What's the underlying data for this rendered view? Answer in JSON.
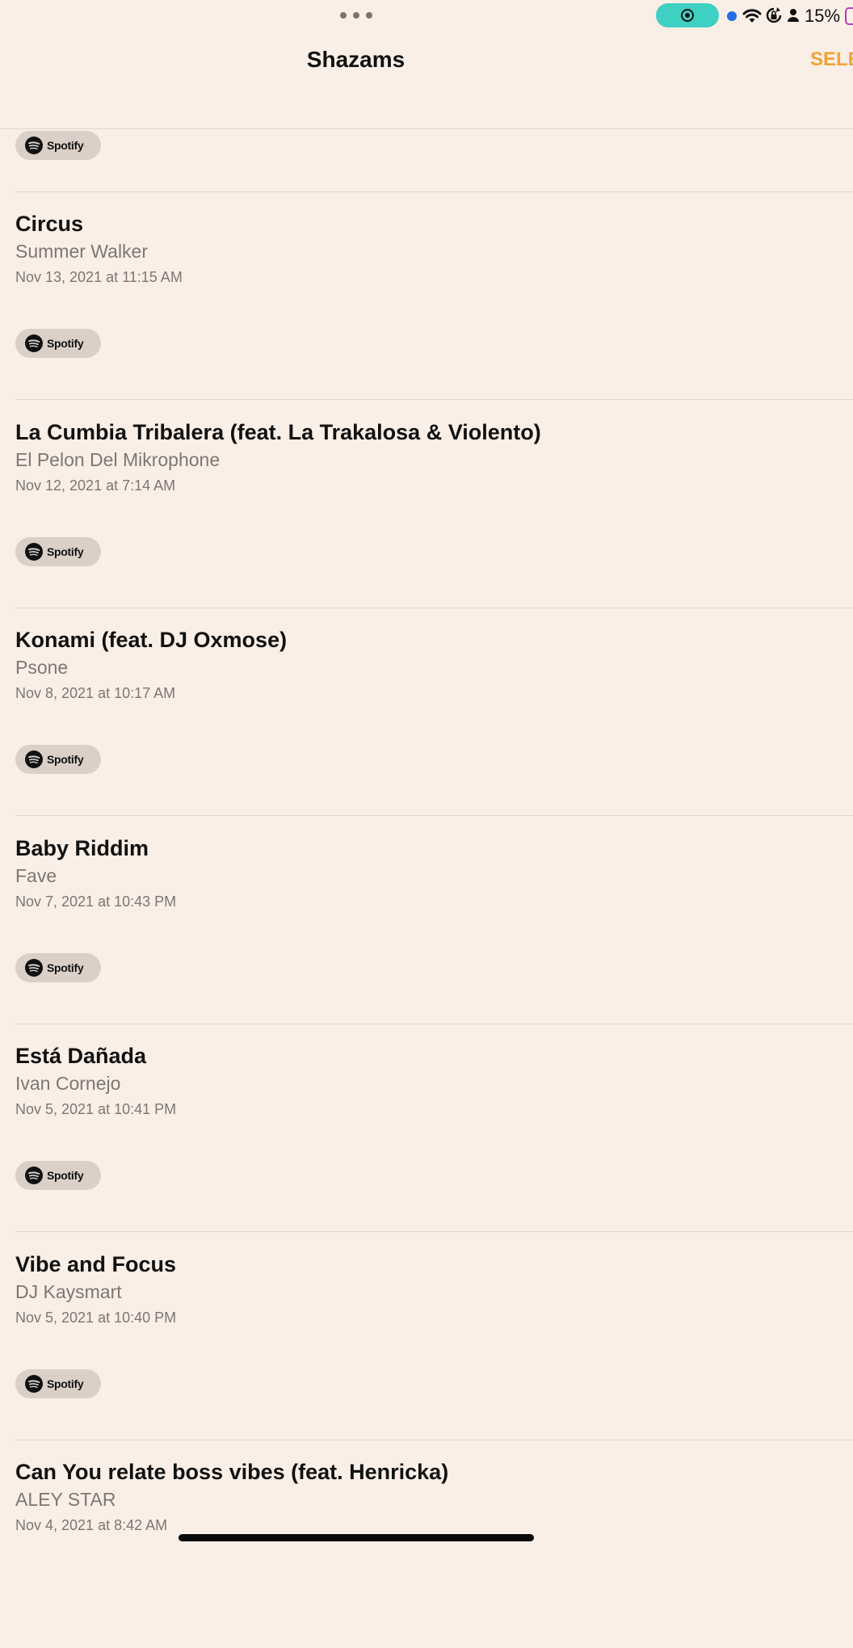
{
  "status_bar": {
    "battery_percent": "15%",
    "recording_color": "#3fd0c4",
    "battery_color": "#b43fb5",
    "icons": [
      "more-dots-icon",
      "screen-record-icon",
      "location-dot-icon",
      "wifi-icon",
      "rotation-lock-icon",
      "person-icon",
      "battery-icon"
    ]
  },
  "header": {
    "title": "Shazams",
    "select_label": "SELECT",
    "accent_color": "#f0a33a"
  },
  "spotify_label": "Spotify",
  "songs": [
    {
      "title": "Circus",
      "artist": "Summer Walker",
      "date": "Nov 13, 2021 at 11:15 AM"
    },
    {
      "title": "La Cumbia Tribalera (feat. La Trakalosa & Violento)",
      "artist": "El Pelon Del Mikrophone",
      "date": "Nov 12, 2021 at 7:14 AM"
    },
    {
      "title": "Konami (feat. DJ Oxmose)",
      "artist": "Psone",
      "date": "Nov 8, 2021 at 10:17 AM"
    },
    {
      "title": "Baby Riddim",
      "artist": "Fave",
      "date": "Nov 7, 2021 at 10:43 PM"
    },
    {
      "title": "Está Dañada",
      "artist": "Ivan Cornejo",
      "date": "Nov 5, 2021 at 10:41 PM"
    },
    {
      "title": "Vibe and Focus",
      "artist": "DJ Kaysmart",
      "date": "Nov 5, 2021 at 10:40 PM"
    },
    {
      "title": "Can You relate boss vibes (feat. Henricka)",
      "artist": "ALEY STAR",
      "date": "Nov 4, 2021 at 8:42 AM"
    }
  ]
}
